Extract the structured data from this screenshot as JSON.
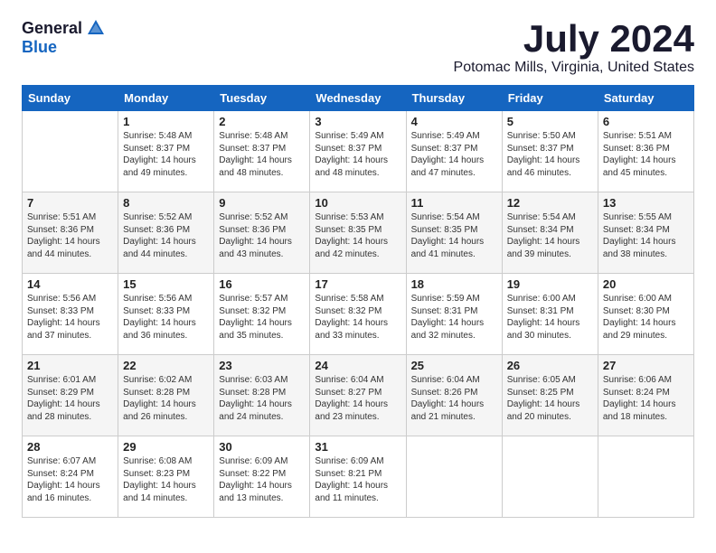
{
  "header": {
    "logo_general": "General",
    "logo_blue": "Blue",
    "month_title": "July 2024",
    "location": "Potomac Mills, Virginia, United States"
  },
  "calendar": {
    "days_of_week": [
      "Sunday",
      "Monday",
      "Tuesday",
      "Wednesday",
      "Thursday",
      "Friday",
      "Saturday"
    ],
    "weeks": [
      [
        {
          "day": "",
          "info": ""
        },
        {
          "day": "1",
          "info": "Sunrise: 5:48 AM\nSunset: 8:37 PM\nDaylight: 14 hours\nand 49 minutes."
        },
        {
          "day": "2",
          "info": "Sunrise: 5:48 AM\nSunset: 8:37 PM\nDaylight: 14 hours\nand 48 minutes."
        },
        {
          "day": "3",
          "info": "Sunrise: 5:49 AM\nSunset: 8:37 PM\nDaylight: 14 hours\nand 48 minutes."
        },
        {
          "day": "4",
          "info": "Sunrise: 5:49 AM\nSunset: 8:37 PM\nDaylight: 14 hours\nand 47 minutes."
        },
        {
          "day": "5",
          "info": "Sunrise: 5:50 AM\nSunset: 8:37 PM\nDaylight: 14 hours\nand 46 minutes."
        },
        {
          "day": "6",
          "info": "Sunrise: 5:51 AM\nSunset: 8:36 PM\nDaylight: 14 hours\nand 45 minutes."
        }
      ],
      [
        {
          "day": "7",
          "info": "Sunrise: 5:51 AM\nSunset: 8:36 PM\nDaylight: 14 hours\nand 44 minutes."
        },
        {
          "day": "8",
          "info": "Sunrise: 5:52 AM\nSunset: 8:36 PM\nDaylight: 14 hours\nand 44 minutes."
        },
        {
          "day": "9",
          "info": "Sunrise: 5:52 AM\nSunset: 8:36 PM\nDaylight: 14 hours\nand 43 minutes."
        },
        {
          "day": "10",
          "info": "Sunrise: 5:53 AM\nSunset: 8:35 PM\nDaylight: 14 hours\nand 42 minutes."
        },
        {
          "day": "11",
          "info": "Sunrise: 5:54 AM\nSunset: 8:35 PM\nDaylight: 14 hours\nand 41 minutes."
        },
        {
          "day": "12",
          "info": "Sunrise: 5:54 AM\nSunset: 8:34 PM\nDaylight: 14 hours\nand 39 minutes."
        },
        {
          "day": "13",
          "info": "Sunrise: 5:55 AM\nSunset: 8:34 PM\nDaylight: 14 hours\nand 38 minutes."
        }
      ],
      [
        {
          "day": "14",
          "info": "Sunrise: 5:56 AM\nSunset: 8:33 PM\nDaylight: 14 hours\nand 37 minutes."
        },
        {
          "day": "15",
          "info": "Sunrise: 5:56 AM\nSunset: 8:33 PM\nDaylight: 14 hours\nand 36 minutes."
        },
        {
          "day": "16",
          "info": "Sunrise: 5:57 AM\nSunset: 8:32 PM\nDaylight: 14 hours\nand 35 minutes."
        },
        {
          "day": "17",
          "info": "Sunrise: 5:58 AM\nSunset: 8:32 PM\nDaylight: 14 hours\nand 33 minutes."
        },
        {
          "day": "18",
          "info": "Sunrise: 5:59 AM\nSunset: 8:31 PM\nDaylight: 14 hours\nand 32 minutes."
        },
        {
          "day": "19",
          "info": "Sunrise: 6:00 AM\nSunset: 8:31 PM\nDaylight: 14 hours\nand 30 minutes."
        },
        {
          "day": "20",
          "info": "Sunrise: 6:00 AM\nSunset: 8:30 PM\nDaylight: 14 hours\nand 29 minutes."
        }
      ],
      [
        {
          "day": "21",
          "info": "Sunrise: 6:01 AM\nSunset: 8:29 PM\nDaylight: 14 hours\nand 28 minutes."
        },
        {
          "day": "22",
          "info": "Sunrise: 6:02 AM\nSunset: 8:28 PM\nDaylight: 14 hours\nand 26 minutes."
        },
        {
          "day": "23",
          "info": "Sunrise: 6:03 AM\nSunset: 8:28 PM\nDaylight: 14 hours\nand 24 minutes."
        },
        {
          "day": "24",
          "info": "Sunrise: 6:04 AM\nSunset: 8:27 PM\nDaylight: 14 hours\nand 23 minutes."
        },
        {
          "day": "25",
          "info": "Sunrise: 6:04 AM\nSunset: 8:26 PM\nDaylight: 14 hours\nand 21 minutes."
        },
        {
          "day": "26",
          "info": "Sunrise: 6:05 AM\nSunset: 8:25 PM\nDaylight: 14 hours\nand 20 minutes."
        },
        {
          "day": "27",
          "info": "Sunrise: 6:06 AM\nSunset: 8:24 PM\nDaylight: 14 hours\nand 18 minutes."
        }
      ],
      [
        {
          "day": "28",
          "info": "Sunrise: 6:07 AM\nSunset: 8:24 PM\nDaylight: 14 hours\nand 16 minutes."
        },
        {
          "day": "29",
          "info": "Sunrise: 6:08 AM\nSunset: 8:23 PM\nDaylight: 14 hours\nand 14 minutes."
        },
        {
          "day": "30",
          "info": "Sunrise: 6:09 AM\nSunset: 8:22 PM\nDaylight: 14 hours\nand 13 minutes."
        },
        {
          "day": "31",
          "info": "Sunrise: 6:09 AM\nSunset: 8:21 PM\nDaylight: 14 hours\nand 11 minutes."
        },
        {
          "day": "",
          "info": ""
        },
        {
          "day": "",
          "info": ""
        },
        {
          "day": "",
          "info": ""
        }
      ]
    ]
  }
}
